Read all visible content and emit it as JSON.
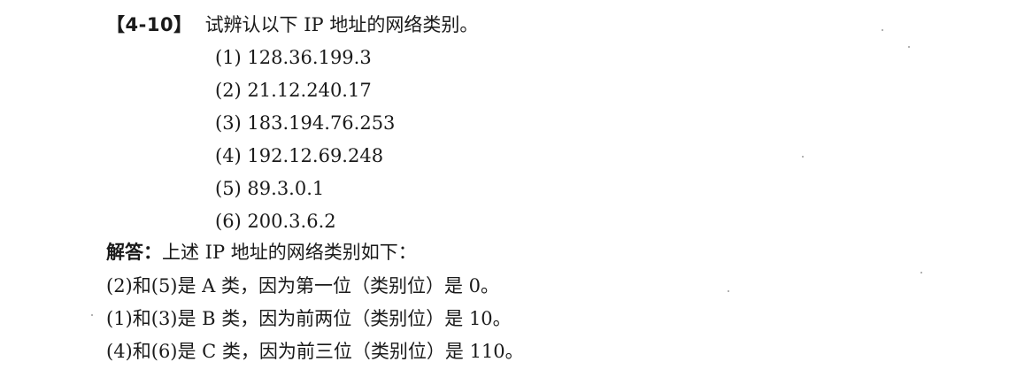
{
  "question": {
    "number": "【4-10】",
    "text": "试辨认以下 IP 地址的网络类别。",
    "options": [
      "(1) 128.36.199.3",
      "(2) 21.12.240.17",
      "(3) 183.194.76.253",
      "(4) 192.12.69.248",
      "(5) 89.3.0.1",
      "(6) 200.3.6.2"
    ]
  },
  "answer": {
    "label": "解答：",
    "intro": "上述 IP 地址的网络类别如下：",
    "lines": [
      "(2)和(5)是 A 类，因为第一位（类别位）是 0。",
      "(1)和(3)是 B 类，因为前两位（类别位）是 10。",
      "(4)和(6)是 C 类，因为前三位（类别位）是 110。"
    ]
  }
}
